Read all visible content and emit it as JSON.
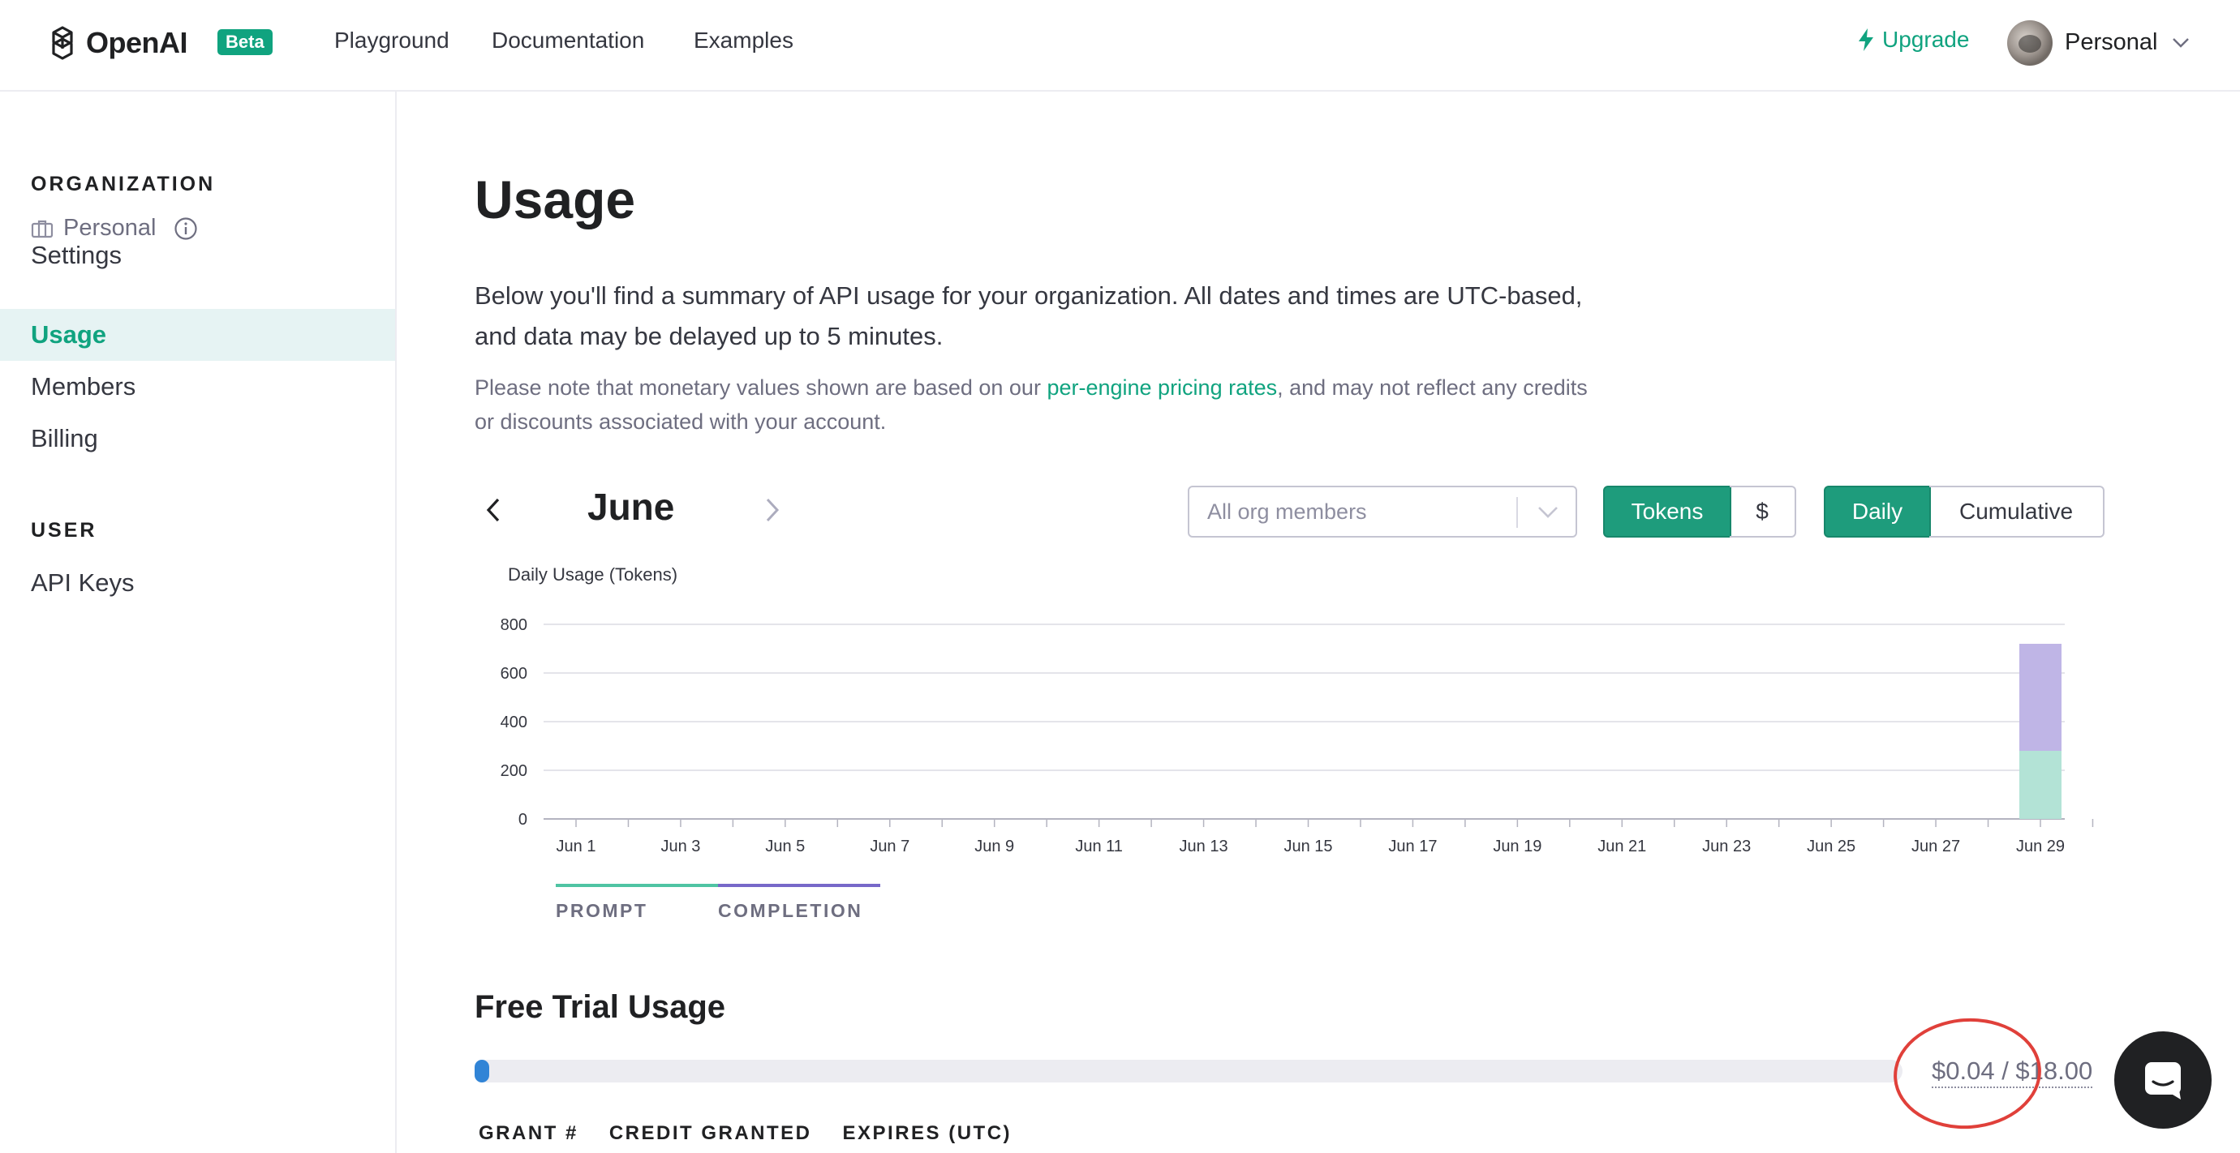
{
  "header": {
    "logo_text": "OpenAI",
    "badge": "Beta",
    "nav": {
      "playground": "Playground",
      "documentation": "Documentation",
      "examples": "Examples"
    },
    "upgrade": "Upgrade",
    "account": "Personal"
  },
  "sidebar": {
    "org_heading": "ORGANIZATION",
    "org_name": "Personal",
    "items": {
      "settings": "Settings",
      "usage": "Usage",
      "members": "Members",
      "billing": "Billing"
    },
    "user_heading": "USER",
    "api_keys": "API Keys"
  },
  "main": {
    "title": "Usage",
    "intro": "Below you'll find a summary of API usage for your organization. All dates and times are UTC-based, and data may be delayed up to 5 minutes.",
    "note_before": "Please note that monetary values shown are based on our ",
    "note_link": "per-engine pricing rates",
    "note_after": ", and may not reflect any credits or discounts associated with your account.",
    "month": "June",
    "member_filter": "All org members",
    "unit_toggle": {
      "tokens": "Tokens",
      "dollar": "$",
      "selected": "Tokens"
    },
    "mode_toggle": {
      "daily": "Daily",
      "cumulative": "Cumulative",
      "selected": "Daily"
    },
    "legend": {
      "prompt": "PROMPT",
      "completion": "COMPLETION"
    },
    "free_trial": {
      "title": "Free Trial Usage",
      "amount_text": "$0.04 / $18.00",
      "used": 0.04,
      "limit": 18.0
    },
    "grant_columns": [
      "GRANT #",
      "CREDIT GRANTED",
      "EXPIRES (UTC)"
    ]
  },
  "colors": {
    "accent": "#10a37f",
    "prompt": "#b3e3d6",
    "completion": "#bfb5e6",
    "prompt_legend": "#4fc4a3",
    "completion_legend": "#7768c9",
    "progress": "#3184d6",
    "annotation": "#e0403a"
  },
  "chart_data": {
    "type": "bar",
    "stacked": true,
    "title": "Daily Usage (Tokens)",
    "xlabel": "",
    "ylabel": "",
    "ylim": [
      0,
      800
    ],
    "yticks": [
      0,
      200,
      400,
      600,
      800
    ],
    "categories": [
      "Jun 1",
      "Jun 2",
      "Jun 3",
      "Jun 4",
      "Jun 5",
      "Jun 6",
      "Jun 7",
      "Jun 8",
      "Jun 9",
      "Jun 10",
      "Jun 11",
      "Jun 12",
      "Jun 13",
      "Jun 14",
      "Jun 15",
      "Jun 16",
      "Jun 17",
      "Jun 18",
      "Jun 19",
      "Jun 20",
      "Jun 21",
      "Jun 22",
      "Jun 23",
      "Jun 24",
      "Jun 25",
      "Jun 26",
      "Jun 27",
      "Jun 28",
      "Jun 29",
      "Jun 30"
    ],
    "x_tick_labels": [
      "Jun 1",
      "Jun 3",
      "Jun 5",
      "Jun 7",
      "Jun 9",
      "Jun 11",
      "Jun 13",
      "Jun 15",
      "Jun 17",
      "Jun 19",
      "Jun 21",
      "Jun 23",
      "Jun 25",
      "Jun 27",
      "Jun 29"
    ],
    "series": [
      {
        "name": "PROMPT",
        "values": [
          0,
          0,
          0,
          0,
          0,
          0,
          0,
          0,
          0,
          0,
          0,
          0,
          0,
          0,
          0,
          0,
          0,
          0,
          0,
          0,
          0,
          0,
          0,
          0,
          0,
          0,
          0,
          0,
          280,
          0
        ]
      },
      {
        "name": "COMPLETION",
        "values": [
          0,
          0,
          0,
          0,
          0,
          0,
          0,
          0,
          0,
          0,
          0,
          0,
          0,
          0,
          0,
          0,
          0,
          0,
          0,
          0,
          0,
          0,
          0,
          0,
          0,
          0,
          0,
          0,
          440,
          0
        ]
      }
    ],
    "grid": true,
    "legend_position": "bottom-left"
  }
}
